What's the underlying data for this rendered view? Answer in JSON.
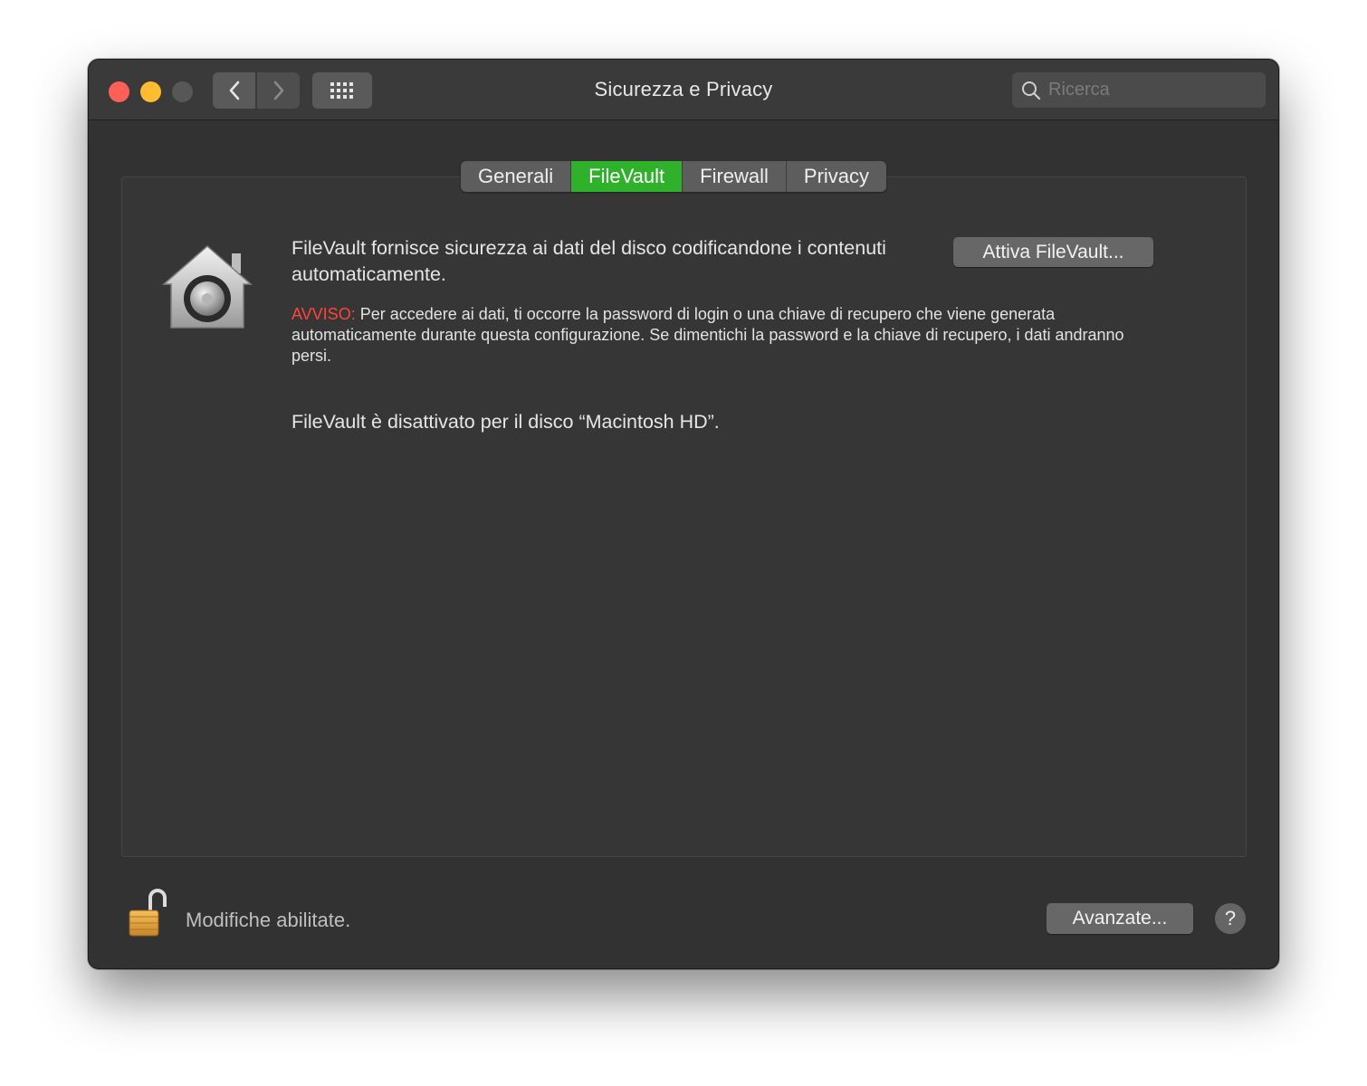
{
  "window": {
    "title": "Sicurezza e Privacy"
  },
  "toolbar": {
    "back_icon": "chevron-left-icon",
    "forward_icon": "chevron-right-icon",
    "grid_icon": "grid-icon",
    "search_placeholder": "Ricerca"
  },
  "tabs": [
    {
      "label": "Generali",
      "active": false
    },
    {
      "label": "FileVault",
      "active": true
    },
    {
      "label": "Firewall",
      "active": false
    },
    {
      "label": "Privacy",
      "active": false
    }
  ],
  "filevault": {
    "icon": "filevault-house-icon",
    "description": "FileVault fornisce sicurezza ai dati del disco codificandone i contenuti automaticamente.",
    "warning_label": "AVVISO:",
    "warning_text": " Per accedere ai dati, ti occorre la password di login o una chiave di recupero che viene generata automaticamente durante questa configurazione. Se dimentichi la password e la chiave di recupero, i dati andranno persi.",
    "status": "FileVault è disattivato per il disco “Macintosh HD”.",
    "activate_button": "Attiva FileVault..."
  },
  "footer": {
    "lock_icon": "unlocked-padlock-icon",
    "lock_status": "Modifiche abilitate.",
    "advanced_button": "Avanzate...",
    "help_label": "?"
  },
  "colors": {
    "accent_tab": "#2fb12c",
    "warning": "#ff453a",
    "close": "#fe5f57",
    "minimize": "#febc2e"
  }
}
